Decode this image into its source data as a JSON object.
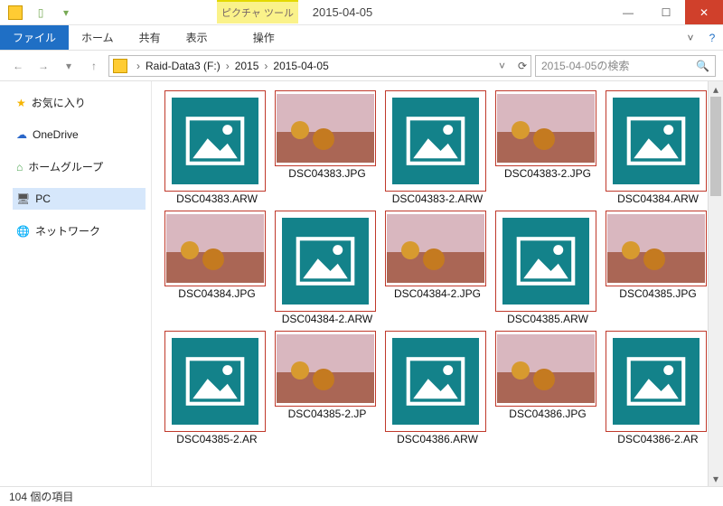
{
  "window": {
    "context_tab": "ピクチャ ツール",
    "title": "2015-04-05"
  },
  "ribbon": {
    "file": "ファイル",
    "tabs": [
      "ホーム",
      "共有",
      "表示",
      "操作"
    ]
  },
  "breadcrumb": {
    "parts": [
      "Raid-Data3 (F:)",
      "2015",
      "2015-04-05"
    ]
  },
  "search": {
    "placeholder": "2015-04-05の検索"
  },
  "sidebar": {
    "favorites": "お気に入り",
    "onedrive": "OneDrive",
    "homegroup": "ホームグループ",
    "pc": "PC",
    "network": "ネットワーク"
  },
  "files": [
    {
      "name": "DSC04383.ARW",
      "kind": "arw"
    },
    {
      "name": "DSC04383.JPG",
      "kind": "jpg"
    },
    {
      "name": "DSC04383-2.ARW",
      "kind": "arw"
    },
    {
      "name": "DSC04383-2.JPG",
      "kind": "jpg"
    },
    {
      "name": "DSC04384.ARW",
      "kind": "arw"
    },
    {
      "name": "DSC04384.JPG",
      "kind": "jpg"
    },
    {
      "name": "DSC04384-2.ARW",
      "kind": "arw"
    },
    {
      "name": "DSC04384-2.JPG",
      "kind": "jpg"
    },
    {
      "name": "DSC04385.ARW",
      "kind": "arw"
    },
    {
      "name": "DSC04385.JPG",
      "kind": "jpg"
    },
    {
      "name": "DSC04385-2.AR",
      "kind": "arw"
    },
    {
      "name": "DSC04385-2.JP",
      "kind": "jpg"
    },
    {
      "name": "DSC04386.ARW",
      "kind": "arw"
    },
    {
      "name": "DSC04386.JPG",
      "kind": "jpg"
    },
    {
      "name": "DSC04386-2.AR",
      "kind": "arw"
    }
  ],
  "status": {
    "count_text": "104 個の項目"
  }
}
